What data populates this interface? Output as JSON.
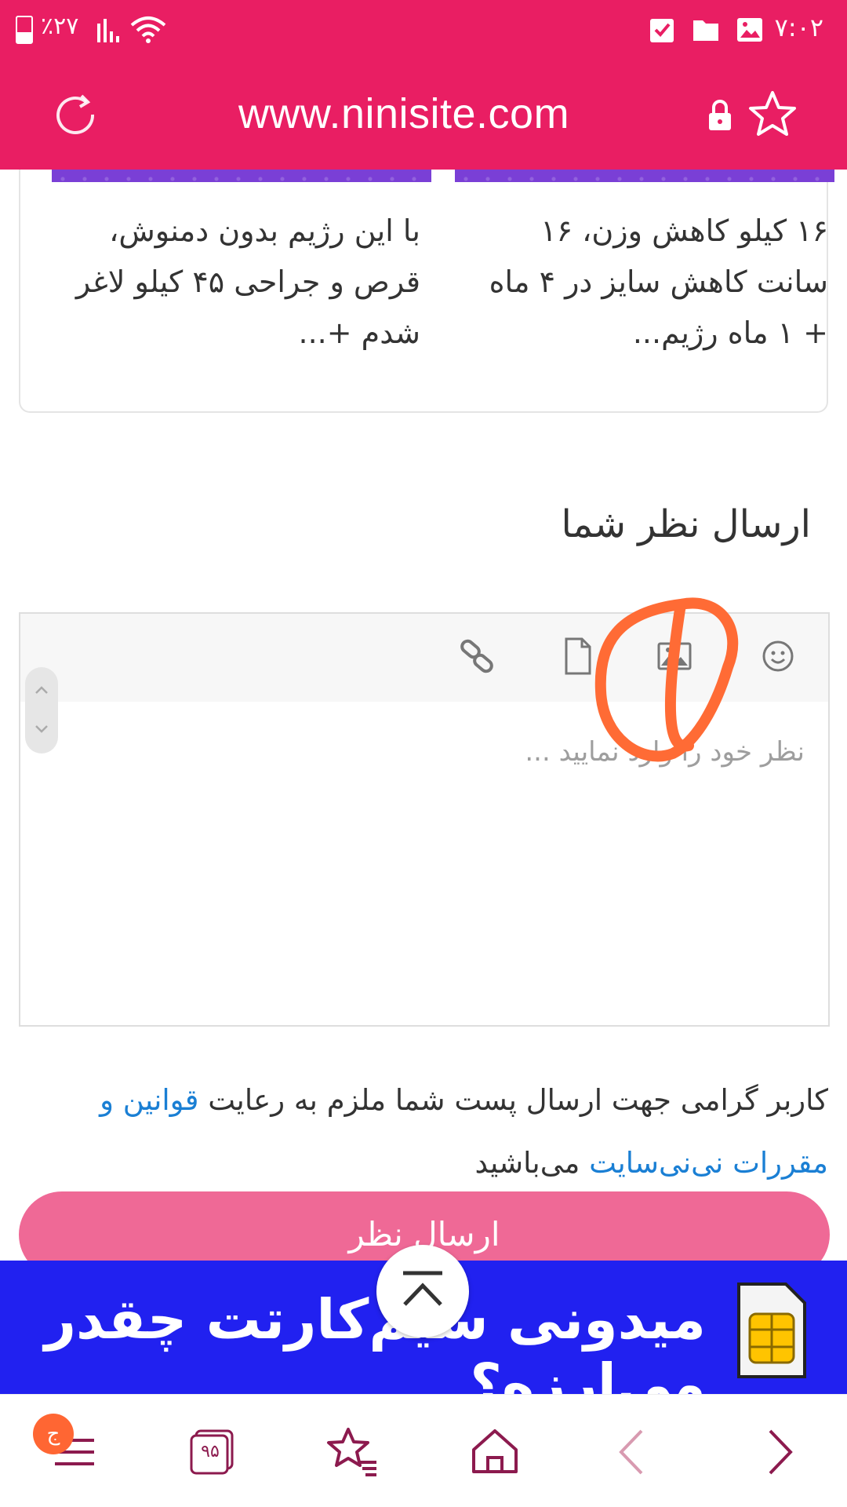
{
  "status_bar": {
    "time": "۷:۰۲",
    "battery": "٪۲۷"
  },
  "address_bar": {
    "url": "www.ninisite.com"
  },
  "related_posts": [
    {
      "title": "۱۶ کیلو کاهش وزن، ۱۶ سانت کاهش سایز در ۴ ماه + ۱ ماه رژیم..."
    },
    {
      "title": "با این رژیم بدون دمنوش، قرص و جراحی ۴۵ کیلو لاغر شدم +..."
    }
  ],
  "comment_section": {
    "title": "ارسال نظر شما",
    "placeholder": "نظر خود را وارد نمایید ...",
    "toolbar": [
      "emoji-icon",
      "image-icon",
      "file-icon",
      "link-icon"
    ],
    "notice_prefix": "کاربر گرامی جهت ارسال پست شما ملزم به رعایت ",
    "notice_link": "قوانین و مقررات نی‌نی‌سایت",
    "notice_suffix": " می‌باشید",
    "submit_label": "ارسال نظر"
  },
  "ad_banner": {
    "text": "میدونی سیم‌کارتت چقدر می‌ارزه؟"
  },
  "bottom_nav": {
    "menu_badge": "ج",
    "tabs_count": "۹۵"
  },
  "colors": {
    "brand": "#e91e63",
    "submit": "#ef6996",
    "link": "#1a7fd4",
    "ad_background": "#2121f0",
    "annotation": "#ff6b35"
  }
}
